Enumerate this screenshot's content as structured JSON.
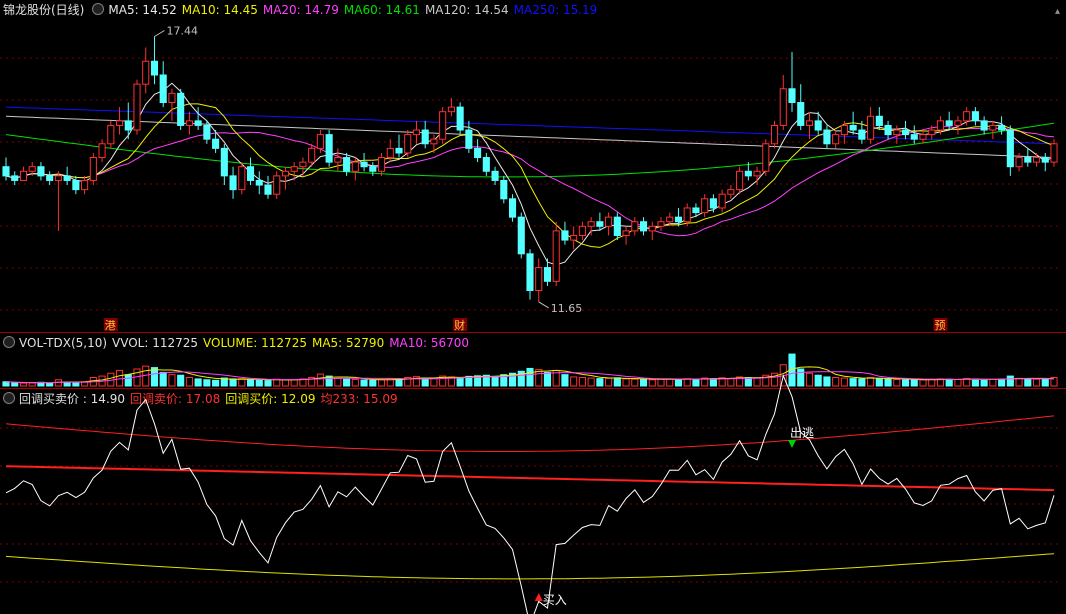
{
  "main": {
    "title": "锦龙股份(日线)",
    "legend": [
      {
        "label": "MA5: 14.52",
        "cls": "ma5"
      },
      {
        "label": "MA10: 14.45",
        "cls": "ma10"
      },
      {
        "label": "MA20: 14.79",
        "cls": "ma20"
      },
      {
        "label": "MA60: 14.61",
        "cls": "ma60"
      },
      {
        "label": "MA120: 14.54",
        "cls": "ma120"
      },
      {
        "label": "MA250: 15.19",
        "cls": "ma250"
      }
    ],
    "high_label": "17.44",
    "low_label": "11.65",
    "markers": [
      "港",
      "财",
      "预"
    ]
  },
  "vol": {
    "title": "VOL-TDX(5,10)",
    "vvol": "VVOL: 112725",
    "volume": "VOLUME: 112725",
    "ma5": "MA5: 52790",
    "ma10": "MA10: 56700"
  },
  "ind": {
    "title": "回调买卖价 : 14.90",
    "sell": "回调卖价: 17.08",
    "buy": "回调买价: 12.09",
    "avg": "均233: 15.09",
    "escape": "出逃",
    "buy_signal": "买入"
  },
  "colors": {
    "up": "#ff3030",
    "down": "#54ffff",
    "grid": "#800000",
    "ma5": "#e8e8e8",
    "ma10": "#f0f000",
    "ma20": "#ff40ff",
    "ma60": "#00e000",
    "ma120": "#c8c8c8",
    "ma250": "#1010ff"
  },
  "chart_data": {
    "type": "candlestick",
    "price_range": [
      11.3,
      17.8
    ],
    "high": 17.44,
    "low": 11.65,
    "candles": [
      [
        14.6,
        14.8,
        14.3,
        14.4
      ],
      [
        14.4,
        14.5,
        14.2,
        14.3
      ],
      [
        14.3,
        14.6,
        14.3,
        14.5
      ],
      [
        14.5,
        14.7,
        14.4,
        14.6
      ],
      [
        14.6,
        14.7,
        14.3,
        14.4
      ],
      [
        14.4,
        14.5,
        14.2,
        14.3
      ],
      [
        14.3,
        14.5,
        13.2,
        14.4
      ],
      [
        14.4,
        14.6,
        14.2,
        14.3
      ],
      [
        14.3,
        14.4,
        14.0,
        14.1
      ],
      [
        14.1,
        14.4,
        14.0,
        14.3
      ],
      [
        14.3,
        14.9,
        14.2,
        14.8
      ],
      [
        14.8,
        15.2,
        14.7,
        15.1
      ],
      [
        15.1,
        15.6,
        15.0,
        15.5
      ],
      [
        15.5,
        15.9,
        15.3,
        15.6
      ],
      [
        15.6,
        16.0,
        15.2,
        15.4
      ],
      [
        15.4,
        16.5,
        15.3,
        16.4
      ],
      [
        16.4,
        17.2,
        16.2,
        16.9
      ],
      [
        16.9,
        17.44,
        16.4,
        16.6
      ],
      [
        16.6,
        16.9,
        15.9,
        16.0
      ],
      [
        16.0,
        16.3,
        15.6,
        16.2
      ],
      [
        16.2,
        16.3,
        15.4,
        15.5
      ],
      [
        15.5,
        15.8,
        15.3,
        15.6
      ],
      [
        15.6,
        15.9,
        15.4,
        15.5
      ],
      [
        15.5,
        15.6,
        15.1,
        15.2
      ],
      [
        15.2,
        15.4,
        14.9,
        15.0
      ],
      [
        15.0,
        15.1,
        14.2,
        14.4
      ],
      [
        14.4,
        14.6,
        13.9,
        14.1
      ],
      [
        14.1,
        14.7,
        14.0,
        14.6
      ],
      [
        14.6,
        14.8,
        14.2,
        14.3
      ],
      [
        14.3,
        14.5,
        14.0,
        14.2
      ],
      [
        14.2,
        14.4,
        13.9,
        14.0
      ],
      [
        14.0,
        14.5,
        13.9,
        14.4
      ],
      [
        14.4,
        14.6,
        14.1,
        14.5
      ],
      [
        14.5,
        14.7,
        14.3,
        14.6
      ],
      [
        14.6,
        14.8,
        14.4,
        14.7
      ],
      [
        14.7,
        15.1,
        14.6,
        15.0
      ],
      [
        15.0,
        15.4,
        14.9,
        15.3
      ],
      [
        15.3,
        15.4,
        14.6,
        14.7
      ],
      [
        14.7,
        15.0,
        14.5,
        14.8
      ],
      [
        14.8,
        14.9,
        14.4,
        14.5
      ],
      [
        14.5,
        14.8,
        14.3,
        14.7
      ],
      [
        14.7,
        14.9,
        14.5,
        14.6
      ],
      [
        14.6,
        14.7,
        14.4,
        14.5
      ],
      [
        14.5,
        14.9,
        14.4,
        14.8
      ],
      [
        14.8,
        15.2,
        14.7,
        15.0
      ],
      [
        15.0,
        15.3,
        14.8,
        14.9
      ],
      [
        14.9,
        15.4,
        14.8,
        15.3
      ],
      [
        15.3,
        15.6,
        15.1,
        15.4
      ],
      [
        15.4,
        15.6,
        15.0,
        15.1
      ],
      [
        15.1,
        15.3,
        14.9,
        15.2
      ],
      [
        15.2,
        15.9,
        15.1,
        15.8
      ],
      [
        15.8,
        16.1,
        15.7,
        15.9
      ],
      [
        15.9,
        16.0,
        15.3,
        15.4
      ],
      [
        15.4,
        15.6,
        14.9,
        15.0
      ],
      [
        15.0,
        15.2,
        14.7,
        14.8
      ],
      [
        14.8,
        14.9,
        14.4,
        14.5
      ],
      [
        14.5,
        14.6,
        14.2,
        14.3
      ],
      [
        14.3,
        14.4,
        13.8,
        13.9
      ],
      [
        13.9,
        14.0,
        13.4,
        13.5
      ],
      [
        13.5,
        13.6,
        12.6,
        12.7
      ],
      [
        12.7,
        12.8,
        11.7,
        11.9
      ],
      [
        11.9,
        12.6,
        11.65,
        12.4
      ],
      [
        12.4,
        12.6,
        12.0,
        12.1
      ],
      [
        12.1,
        13.4,
        12.0,
        13.2
      ],
      [
        13.2,
        13.4,
        12.9,
        13.0
      ],
      [
        13.0,
        13.3,
        12.8,
        13.1
      ],
      [
        13.1,
        13.4,
        13.0,
        13.3
      ],
      [
        13.3,
        13.5,
        13.1,
        13.4
      ],
      [
        13.4,
        13.6,
        13.2,
        13.3
      ],
      [
        13.3,
        13.6,
        13.1,
        13.5
      ],
      [
        13.5,
        13.6,
        13.0,
        13.1
      ],
      [
        13.1,
        13.3,
        12.9,
        13.2
      ],
      [
        13.2,
        13.5,
        13.1,
        13.4
      ],
      [
        13.4,
        13.5,
        13.1,
        13.2
      ],
      [
        13.2,
        13.4,
        13.0,
        13.3
      ],
      [
        13.3,
        13.5,
        13.2,
        13.4
      ],
      [
        13.4,
        13.6,
        13.3,
        13.5
      ],
      [
        13.5,
        13.7,
        13.3,
        13.4
      ],
      [
        13.4,
        13.8,
        13.3,
        13.7
      ],
      [
        13.7,
        13.8,
        13.5,
        13.6
      ],
      [
        13.6,
        14.0,
        13.5,
        13.9
      ],
      [
        13.9,
        14.0,
        13.6,
        13.7
      ],
      [
        13.7,
        14.1,
        13.6,
        14.0
      ],
      [
        14.0,
        14.2,
        13.9,
        14.1
      ],
      [
        14.1,
        14.6,
        14.0,
        14.5
      ],
      [
        14.5,
        14.7,
        14.3,
        14.4
      ],
      [
        14.4,
        14.6,
        14.2,
        14.5
      ],
      [
        14.5,
        15.2,
        14.4,
        15.1
      ],
      [
        15.1,
        15.6,
        15.0,
        15.5
      ],
      [
        15.5,
        16.6,
        15.4,
        16.3
      ],
      [
        16.3,
        17.1,
        15.8,
        16.0
      ],
      [
        16.0,
        16.4,
        15.4,
        15.5
      ],
      [
        15.5,
        15.8,
        15.2,
        15.6
      ],
      [
        15.6,
        15.8,
        15.3,
        15.4
      ],
      [
        15.4,
        15.5,
        15.0,
        15.1
      ],
      [
        15.1,
        15.4,
        15.0,
        15.3
      ],
      [
        15.3,
        15.6,
        15.1,
        15.5
      ],
      [
        15.5,
        15.8,
        15.3,
        15.4
      ],
      [
        15.4,
        15.6,
        15.1,
        15.2
      ],
      [
        15.2,
        15.9,
        15.1,
        15.7
      ],
      [
        15.7,
        15.9,
        15.4,
        15.5
      ],
      [
        15.5,
        15.6,
        15.2,
        15.3
      ],
      [
        15.3,
        15.5,
        15.1,
        15.4
      ],
      [
        15.4,
        15.6,
        15.2,
        15.3
      ],
      [
        15.3,
        15.5,
        15.1,
        15.2
      ],
      [
        15.2,
        15.4,
        15.1,
        15.3
      ],
      [
        15.3,
        15.5,
        15.2,
        15.4
      ],
      [
        15.4,
        15.7,
        15.3,
        15.6
      ],
      [
        15.6,
        15.8,
        15.4,
        15.5
      ],
      [
        15.5,
        15.7,
        15.3,
        15.6
      ],
      [
        15.6,
        15.9,
        15.5,
        15.8
      ],
      [
        15.8,
        15.9,
        15.5,
        15.6
      ],
      [
        15.6,
        15.7,
        15.3,
        15.4
      ],
      [
        15.4,
        15.6,
        15.2,
        15.5
      ],
      [
        15.5,
        15.7,
        15.3,
        15.4
      ],
      [
        15.4,
        15.5,
        14.4,
        14.6
      ],
      [
        14.6,
        14.9,
        14.5,
        14.8
      ],
      [
        14.8,
        15.0,
        14.6,
        14.7
      ],
      [
        14.7,
        14.9,
        14.6,
        14.8
      ],
      [
        14.8,
        14.9,
        14.5,
        14.7
      ],
      [
        14.7,
        15.2,
        14.6,
        15.1
      ]
    ],
    "volume_scale": [
      0,
      120000
    ],
    "volumes": [
      15000,
      12000,
      10000,
      11000,
      13000,
      9000,
      22000,
      14000,
      12000,
      15000,
      30000,
      35000,
      45000,
      55000,
      40000,
      60000,
      70000,
      65000,
      48000,
      40000,
      38000,
      30000,
      25000,
      22000,
      20000,
      28000,
      25000,
      26000,
      21000,
      20000,
      19000,
      24000,
      22000,
      23000,
      25000,
      30000,
      42000,
      35000,
      27000,
      24000,
      23000,
      21000,
      20000,
      22000,
      26000,
      25000,
      30000,
      33000,
      28000,
      26000,
      35000,
      32000,
      30000,
      34000,
      36000,
      38000,
      34000,
      40000,
      45000,
      52000,
      62000,
      58000,
      48000,
      55000,
      40000,
      32000,
      30000,
      28000,
      26000,
      27000,
      29000,
      25000,
      24000,
      23000,
      22000,
      24000,
      25000,
      23000,
      26000,
      24000,
      28000,
      26000,
      29000,
      27000,
      32000,
      30000,
      29000,
      38000,
      45000,
      75000,
      112725,
      60000,
      45000,
      38000,
      32000,
      30000,
      28000,
      26000,
      25000,
      30000,
      27000,
      24000,
      23000,
      22000,
      21000,
      22000,
      23000,
      25000,
      24000,
      23000,
      26000,
      24000,
      22000,
      23000,
      24000,
      35000,
      27000,
      25000,
      24000,
      23000,
      30000
    ]
  }
}
